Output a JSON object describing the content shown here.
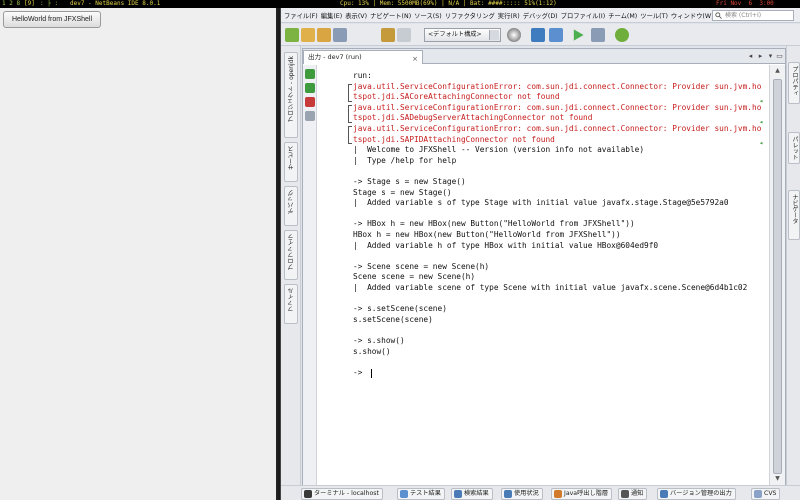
{
  "statusbar": {
    "workspaces": "1 2 8",
    "current": "[9]",
    "layout": ": ├ :",
    "window_title": "dev7 - NetBeans IDE 8.0.1",
    "cpu": "Cpu: 13% | Mem: 5500MB(69%) | N/A | Bat: ####::::: 51%(1:12)",
    "date": "Fri Nov  6  3:00"
  },
  "jfx_window": {
    "button_label": "HelloWorld from JFXShell"
  },
  "netbeans": {
    "menus": [
      "ファイル(F)",
      "編集(E)",
      "表示(V)",
      "ナビゲート(N)",
      "ソース(S)",
      "リファクタリング",
      "実行(R)",
      "デバッグ(D)",
      "プロファイル(I)",
      "チーム(M)",
      "ツール(T)",
      "ウィンドウ(W)",
      "ヘルプ(H)"
    ],
    "search_placeholder": "検索 (Ctrl+I)",
    "config_combo": "<デフォルト構成>",
    "left_tabs": [
      "プロジェクト - openjdk",
      "サービス",
      "デバッグ",
      "プロファイラ",
      "ファイル"
    ],
    "right_tabs": [
      "プロパティ",
      "パレット",
      "ナビゲータ"
    ],
    "output_tab": "出力 - dev7 (run)",
    "console_lines": [
      {
        "text": "run:",
        "type": "normal"
      },
      {
        "text": "java.util.ServiceConfigurationError: com.sun.jdi.connect.Connector: Provider sun.jvm.ho",
        "type": "err"
      },
      {
        "text": "tspot.jdi.SACoreAttachingConnector not found",
        "type": "err"
      },
      {
        "text": "java.util.ServiceConfigurationError: com.sun.jdi.connect.Connector: Provider sun.jvm.ho",
        "type": "err"
      },
      {
        "text": "tspot.jdi.SADebugServerAttachingConnector not found",
        "type": "err"
      },
      {
        "text": "java.util.ServiceConfigurationError: com.sun.jdi.connect.Connector: Provider sun.jvm.ho",
        "type": "err"
      },
      {
        "text": "tspot.jdi.SAPIDAttachingConnector not found",
        "type": "err"
      },
      {
        "text": "|  Welcome to JFXShell -- Version (version info not available)",
        "type": "normal"
      },
      {
        "text": "|  Type /help for help",
        "type": "normal"
      },
      {
        "text": "",
        "type": "normal"
      },
      {
        "text": "-> Stage s = new Stage()",
        "type": "normal"
      },
      {
        "text": "Stage s = new Stage()",
        "type": "normal"
      },
      {
        "text": "|  Added variable s of type Stage with initial value javafx.stage.Stage@5e5792a0",
        "type": "normal"
      },
      {
        "text": "",
        "type": "normal"
      },
      {
        "text": "-> HBox h = new HBox(new Button(\"HelloWorld from JFXShell\"))",
        "type": "normal"
      },
      {
        "text": "HBox h = new HBox(new Button(\"HelloWorld from JFXShell\"))",
        "type": "normal"
      },
      {
        "text": "|  Added variable h of type HBox with initial value HBox@604ed9f0",
        "type": "normal"
      },
      {
        "text": "",
        "type": "normal"
      },
      {
        "text": "-> Scene scene = new Scene(h)",
        "type": "normal"
      },
      {
        "text": "Scene scene = new Scene(h)",
        "type": "normal"
      },
      {
        "text": "|  Added variable scene of type Scene with initial value javafx.scene.Scene@6d4b1c02",
        "type": "normal"
      },
      {
        "text": "",
        "type": "normal"
      },
      {
        "text": "-> s.setScene(scene)",
        "type": "normal"
      },
      {
        "text": "s.setScene(scene)",
        "type": "normal"
      },
      {
        "text": "",
        "type": "normal"
      },
      {
        "text": "-> s.show()",
        "type": "normal"
      },
      {
        "text": "s.show()",
        "type": "normal"
      },
      {
        "text": "",
        "type": "normal"
      },
      {
        "text": "-> ",
        "type": "normal"
      }
    ],
    "bottom_tabs": [
      "ターミナル - localhost",
      "テスト結果",
      "検索結果",
      "使用状況",
      "Java呼出し階層",
      "通知",
      "バージョン管理の出力",
      "CVS"
    ]
  }
}
